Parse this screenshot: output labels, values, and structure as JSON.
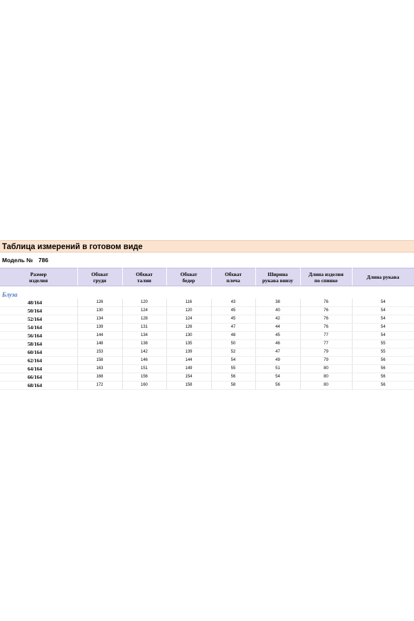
{
  "title": "Таблица измерений в готовом виде",
  "model": {
    "label": "Модель №",
    "number": "786"
  },
  "table": {
    "headers": [
      [
        "Размер",
        "изделия"
      ],
      [
        "Обхват",
        "груди"
      ],
      [
        "Обхват",
        "талии"
      ],
      [
        "Обхват",
        "бедер"
      ],
      [
        "Обхват",
        "плеча"
      ],
      [
        "Ширина",
        "рукава внизу"
      ],
      [
        "Длина изделия",
        "по спинке"
      ],
      [
        "Длина рукава"
      ]
    ],
    "group_label": "Блуза",
    "rows": [
      [
        "48/164",
        "126",
        "120",
        "116",
        "43",
        "38",
        "76",
        "54"
      ],
      [
        "50/164",
        "130",
        "124",
        "120",
        "45",
        "40",
        "76",
        "54"
      ],
      [
        "52/164",
        "134",
        "128",
        "124",
        "45",
        "42",
        "76",
        "54"
      ],
      [
        "54/164",
        "139",
        "131",
        "126",
        "47",
        "44",
        "76",
        "54"
      ],
      [
        "56/164",
        "144",
        "134",
        "130",
        "48",
        "45",
        "77",
        "54"
      ],
      [
        "58/164",
        "148",
        "138",
        "135",
        "50",
        "46",
        "77",
        "55"
      ],
      [
        "60/164",
        "153",
        "142",
        "139",
        "52",
        "47",
        "79",
        "55"
      ],
      [
        "62/164",
        "158",
        "146",
        "144",
        "54",
        "49",
        "79",
        "56"
      ],
      [
        "64/164",
        "163",
        "151",
        "149",
        "55",
        "51",
        "80",
        "56"
      ],
      [
        "66/164",
        "168",
        "156",
        "154",
        "56",
        "54",
        "80",
        "56"
      ],
      [
        "68/164",
        "172",
        "160",
        "158",
        "58",
        "56",
        "80",
        "56"
      ]
    ]
  },
  "colors": {
    "title_background": "#fbe3cf",
    "header_background": "#dcd8ef",
    "group_label": "#4f79c4"
  }
}
